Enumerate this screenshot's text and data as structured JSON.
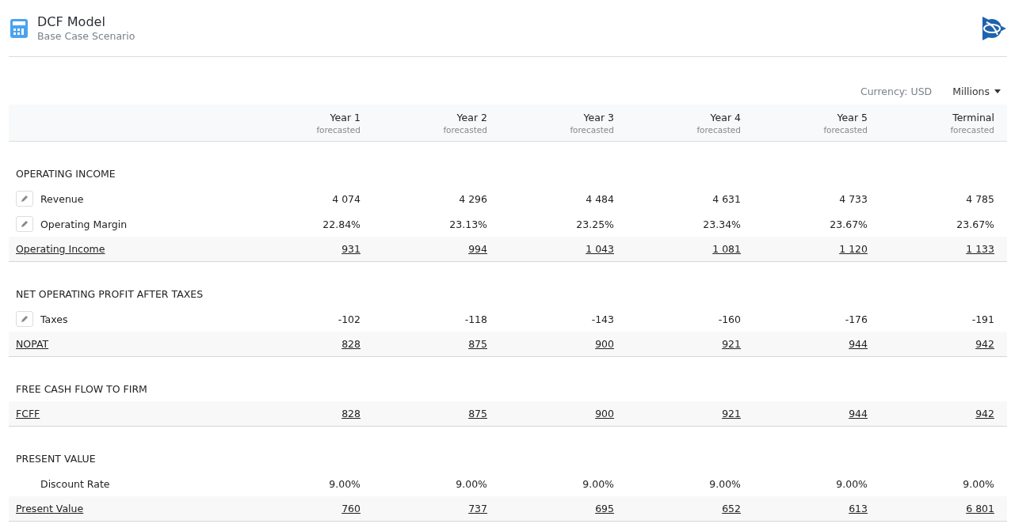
{
  "header": {
    "title": "DCF Model",
    "subtitle": "Base Case Scenario"
  },
  "toolbar": {
    "currency": "Currency: USD",
    "unit": "Millions"
  },
  "columns": [
    {
      "label": "Year 1",
      "sub": "forecasted"
    },
    {
      "label": "Year 2",
      "sub": "forecasted"
    },
    {
      "label": "Year 3",
      "sub": "forecasted"
    },
    {
      "label": "Year 4",
      "sub": "forecasted"
    },
    {
      "label": "Year 5",
      "sub": "forecasted"
    },
    {
      "label": "Terminal",
      "sub": "forecasted"
    }
  ],
  "sections": [
    {
      "title": "OPERATING INCOME",
      "rows": [
        {
          "kind": "editable",
          "label": "Revenue",
          "values": [
            "4 074",
            "4 296",
            "4 484",
            "4 631",
            "4 733",
            "4 785"
          ]
        },
        {
          "kind": "editable",
          "label": "Operating Margin",
          "values": [
            "22.84%",
            "23.13%",
            "23.25%",
            "23.34%",
            "23.67%",
            "23.67%"
          ]
        },
        {
          "kind": "total",
          "label": "Operating Income",
          "values": [
            "931",
            "994",
            "1 043",
            "1 081",
            "1 120",
            "1 133"
          ]
        }
      ]
    },
    {
      "title": "NET OPERATING PROFIT AFTER TAXES",
      "rows": [
        {
          "kind": "editable",
          "label": "Taxes",
          "values": [
            "-102",
            "-118",
            "-143",
            "-160",
            "-176",
            "-191"
          ]
        },
        {
          "kind": "total",
          "label": "NOPAT",
          "values": [
            "828",
            "875",
            "900",
            "921",
            "944",
            "942"
          ]
        }
      ]
    },
    {
      "title": "FREE CASH FLOW TO FIRM",
      "rows": [
        {
          "kind": "total",
          "label": "FCFF",
          "values": [
            "828",
            "875",
            "900",
            "921",
            "944",
            "942"
          ]
        }
      ]
    },
    {
      "title": "PRESENT VALUE",
      "rows": [
        {
          "kind": "plain",
          "label": "Discount Rate",
          "values": [
            "9.00%",
            "9.00%",
            "9.00%",
            "9.00%",
            "9.00%",
            "9.00%"
          ]
        },
        {
          "kind": "total",
          "label": "Present Value",
          "values": [
            "760",
            "737",
            "695",
            "652",
            "613",
            "6 801"
          ]
        }
      ]
    }
  ]
}
